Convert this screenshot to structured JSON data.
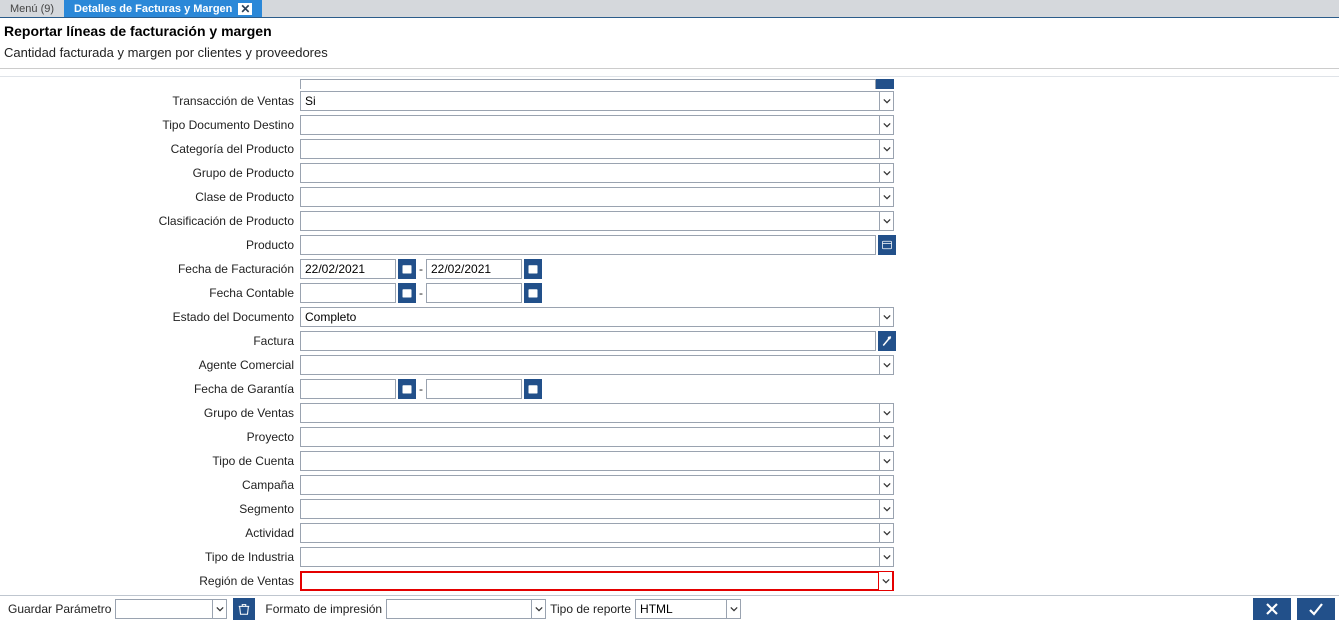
{
  "tabs": {
    "menu": "Menú (9)",
    "active": "Detalles de Facturas y Margen"
  },
  "header": {
    "title": "Reportar líneas de facturación y margen",
    "subtitle": "Cantidad facturada y margen por clientes y proveedores"
  },
  "fields": {
    "transaccion_ventas": {
      "label": "Transacción de Ventas",
      "value": "Si"
    },
    "tipo_doc_destino": {
      "label": "Tipo Documento Destino",
      "value": ""
    },
    "categoria_producto": {
      "label": "Categoría del Producto",
      "value": ""
    },
    "grupo_producto": {
      "label": "Grupo de Producto",
      "value": ""
    },
    "clase_producto": {
      "label": "Clase de Producto",
      "value": ""
    },
    "clasificacion_producto": {
      "label": "Clasificación de Producto",
      "value": ""
    },
    "producto": {
      "label": "Producto",
      "value": ""
    },
    "fecha_facturacion": {
      "label": "Fecha de Facturación",
      "from": "22/02/2021",
      "to": "22/02/2021"
    },
    "fecha_contable": {
      "label": "Fecha Contable",
      "from": "",
      "to": ""
    },
    "estado_documento": {
      "label": "Estado del Documento",
      "value": "Completo"
    },
    "factura": {
      "label": "Factura",
      "value": ""
    },
    "agente_comercial": {
      "label": "Agente Comercial",
      "value": ""
    },
    "fecha_garantia": {
      "label": "Fecha de Garantía",
      "from": "",
      "to": ""
    },
    "grupo_ventas": {
      "label": "Grupo de Ventas",
      "value": ""
    },
    "proyecto": {
      "label": "Proyecto",
      "value": ""
    },
    "tipo_cuenta": {
      "label": "Tipo de Cuenta",
      "value": ""
    },
    "campana": {
      "label": "Campaña",
      "value": ""
    },
    "segmento": {
      "label": "Segmento",
      "value": ""
    },
    "actividad": {
      "label": "Actividad",
      "value": ""
    },
    "tipo_industria": {
      "label": "Tipo de Industria",
      "value": ""
    },
    "region_ventas": {
      "label": "Región de Ventas",
      "value": ""
    }
  },
  "footer": {
    "guardar_parametro": {
      "label": "Guardar Parámetro",
      "value": ""
    },
    "formato_impresion": {
      "label": "Formato de impresión",
      "value": ""
    },
    "tipo_reporte": {
      "label": "Tipo de reporte",
      "value": "HTML"
    }
  }
}
